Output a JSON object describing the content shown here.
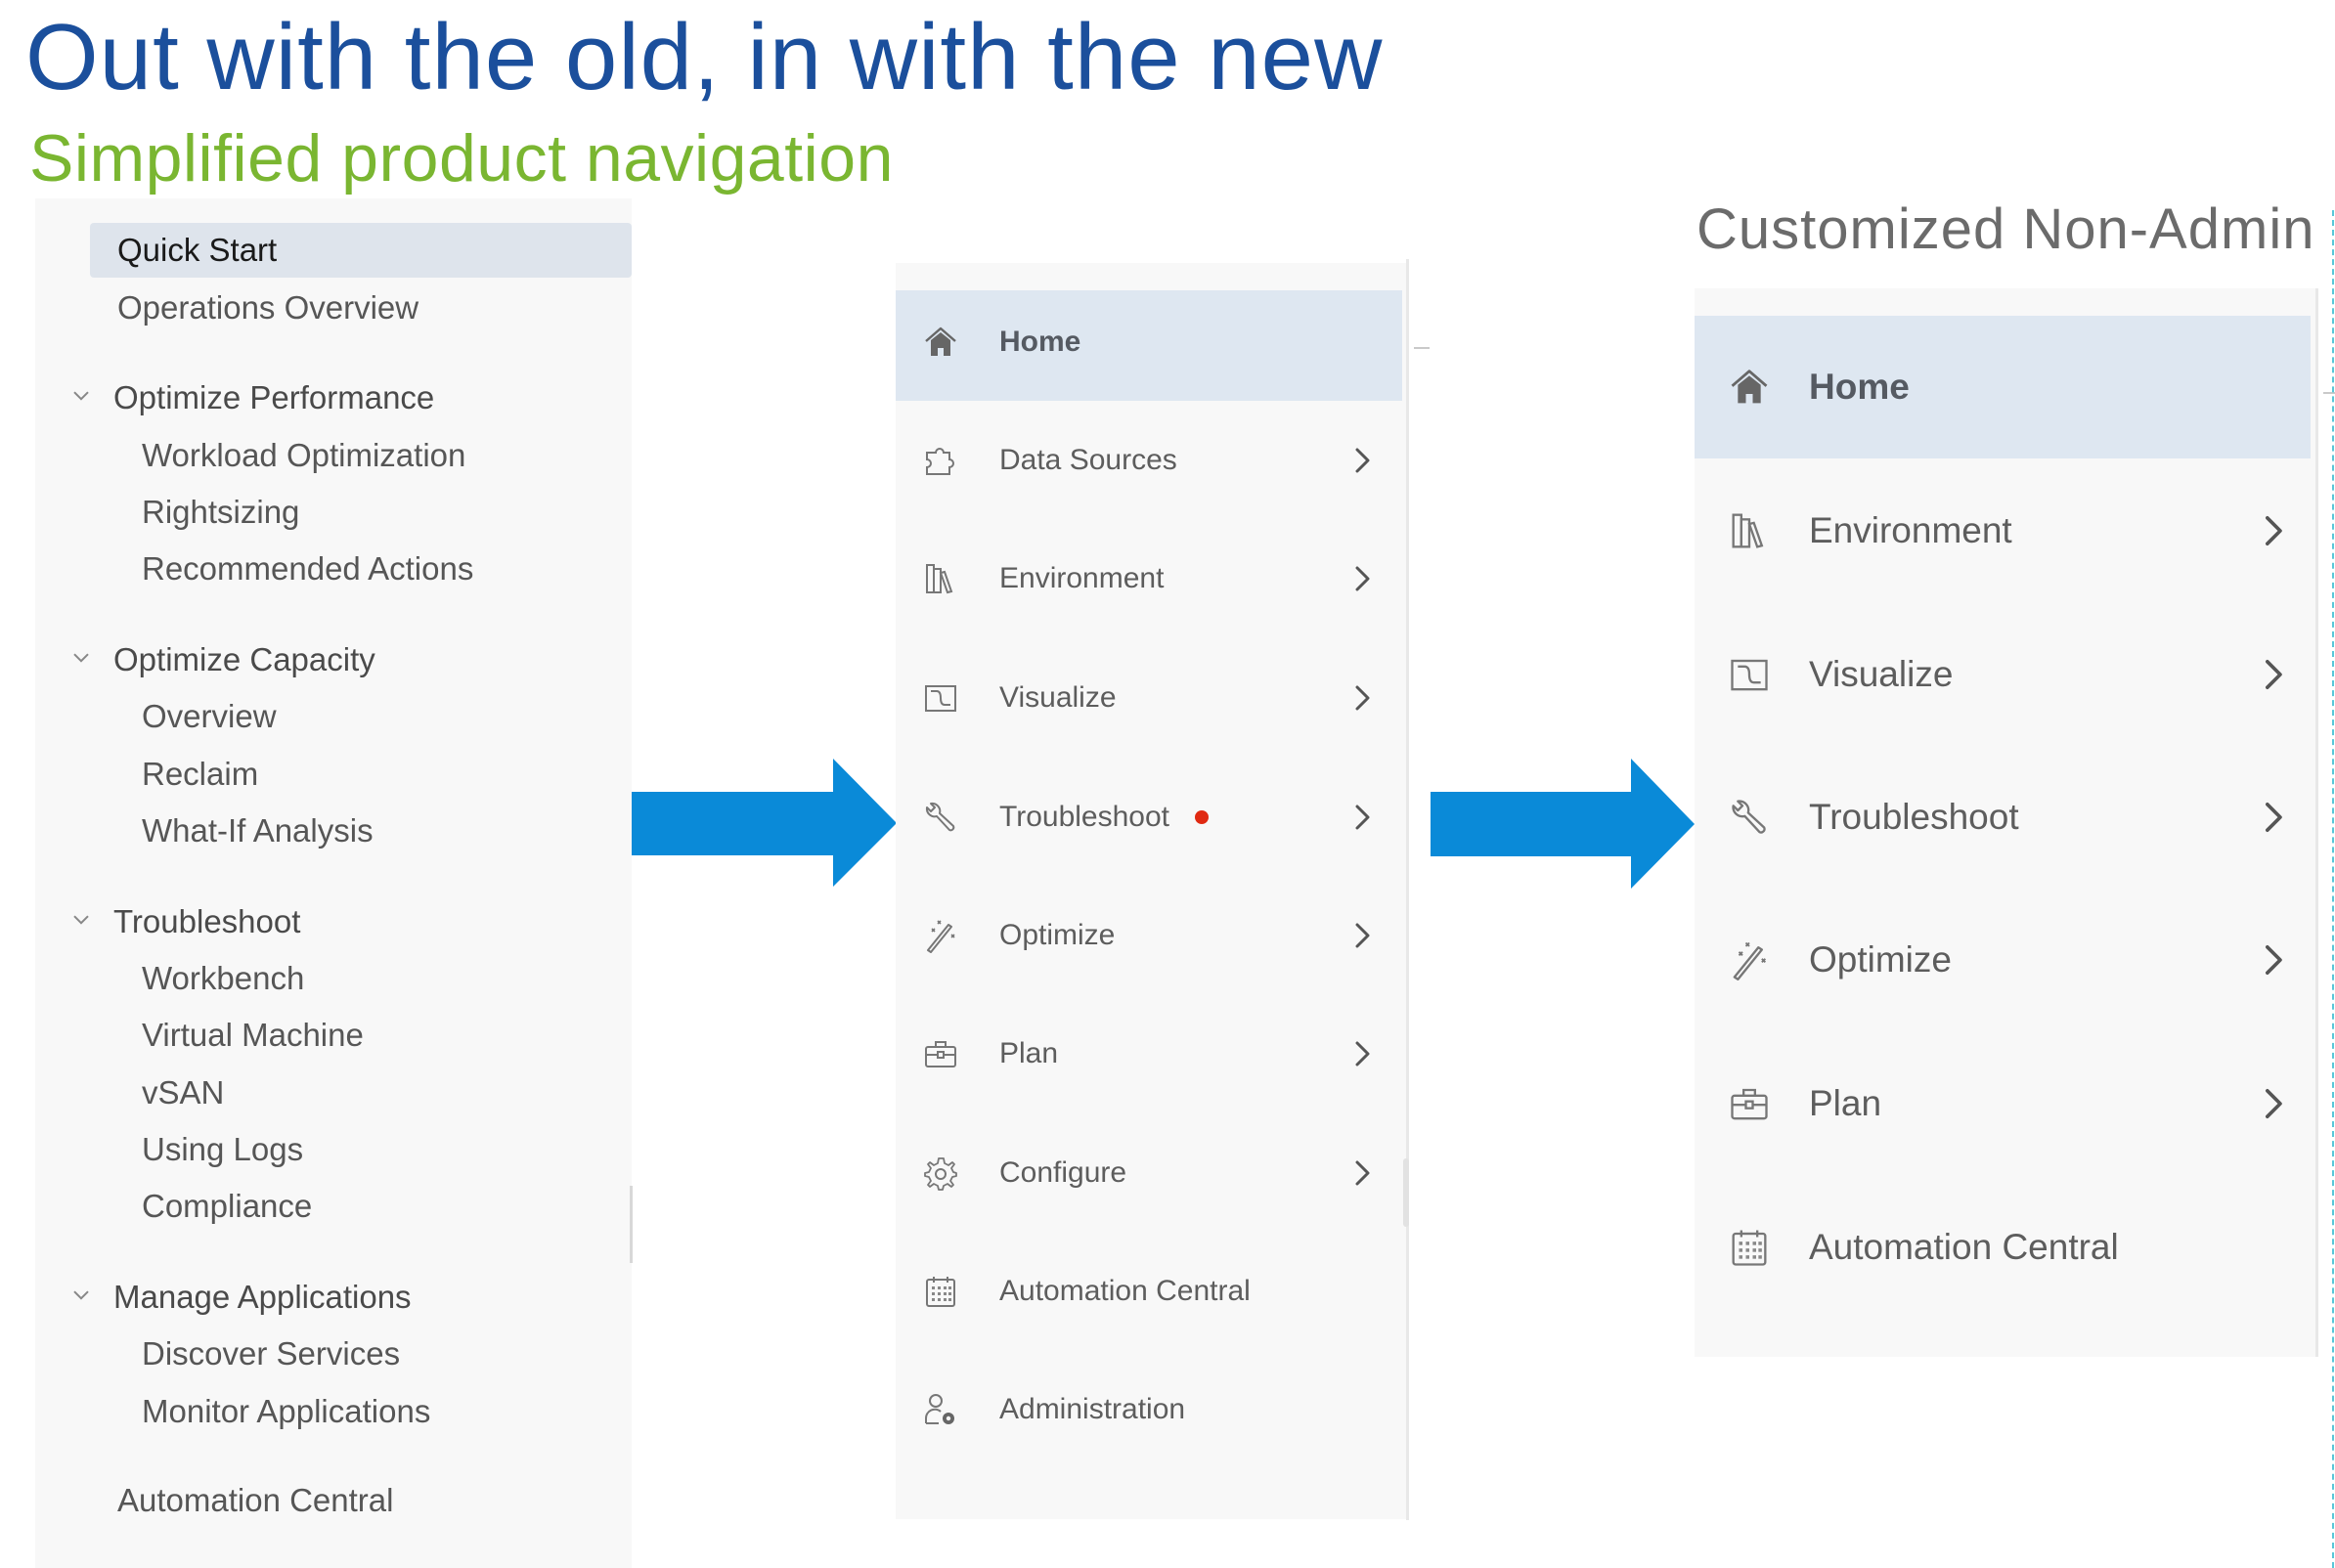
{
  "slide": {
    "title": "Out with the old, in with the new",
    "subtitle": "Simplified product navigation",
    "right_caption": "Customized Non-Admin"
  },
  "colors": {
    "title": "#1b4f9c",
    "subtitle": "#7ab631",
    "arrow": "#0a8ad8",
    "highlight": "#dee7f1",
    "badge": "#e02a12"
  },
  "old_nav": {
    "quick_start": "Quick Start",
    "operations_overview": "Operations Overview",
    "groups": [
      {
        "label": "Optimize Performance",
        "expanded": true,
        "children": [
          "Workload Optimization",
          "Rightsizing",
          "Recommended Actions"
        ]
      },
      {
        "label": "Optimize Capacity",
        "expanded": true,
        "children": [
          "Overview",
          "Reclaim",
          "What-If Analysis"
        ]
      },
      {
        "label": "Troubleshoot",
        "expanded": true,
        "children": [
          "Workbench",
          "Virtual Machine",
          "vSAN",
          "Using Logs",
          "Compliance"
        ]
      },
      {
        "label": "Manage Applications",
        "expanded": true,
        "children": [
          "Discover Services",
          "Monitor Applications"
        ]
      }
    ],
    "automation_central": "Automation Central",
    "selected": "Quick Start"
  },
  "new_nav": {
    "selected": "Home",
    "items": [
      {
        "label": "Home",
        "icon": "home-icon",
        "chevron": false
      },
      {
        "label": "Data Sources",
        "icon": "puzzle-icon",
        "chevron": true
      },
      {
        "label": "Environment",
        "icon": "books-icon",
        "chevron": true
      },
      {
        "label": "Visualize",
        "icon": "chart-window-icon",
        "chevron": true
      },
      {
        "label": "Troubleshoot",
        "icon": "wrench-icon",
        "chevron": true,
        "badge": "red-dot"
      },
      {
        "label": "Optimize",
        "icon": "magic-wand-icon",
        "chevron": true
      },
      {
        "label": "Plan",
        "icon": "toolbox-icon",
        "chevron": true
      },
      {
        "label": "Configure",
        "icon": "gear-icon",
        "chevron": true
      },
      {
        "label": "Automation Central",
        "icon": "calendar-icon",
        "chevron": false
      },
      {
        "label": "Administration",
        "icon": "user-gear-icon",
        "chevron": false
      }
    ]
  },
  "non_admin_nav": {
    "selected": "Home",
    "items": [
      {
        "label": "Home",
        "icon": "home-icon",
        "chevron": false
      },
      {
        "label": "Environment",
        "icon": "books-icon",
        "chevron": true
      },
      {
        "label": "Visualize",
        "icon": "chart-window-icon",
        "chevron": true
      },
      {
        "label": "Troubleshoot",
        "icon": "wrench-icon",
        "chevron": true
      },
      {
        "label": "Optimize",
        "icon": "magic-wand-icon",
        "chevron": true
      },
      {
        "label": "Plan",
        "icon": "toolbox-icon",
        "chevron": true
      },
      {
        "label": "Automation Central",
        "icon": "calendar-icon",
        "chevron": false
      }
    ]
  }
}
